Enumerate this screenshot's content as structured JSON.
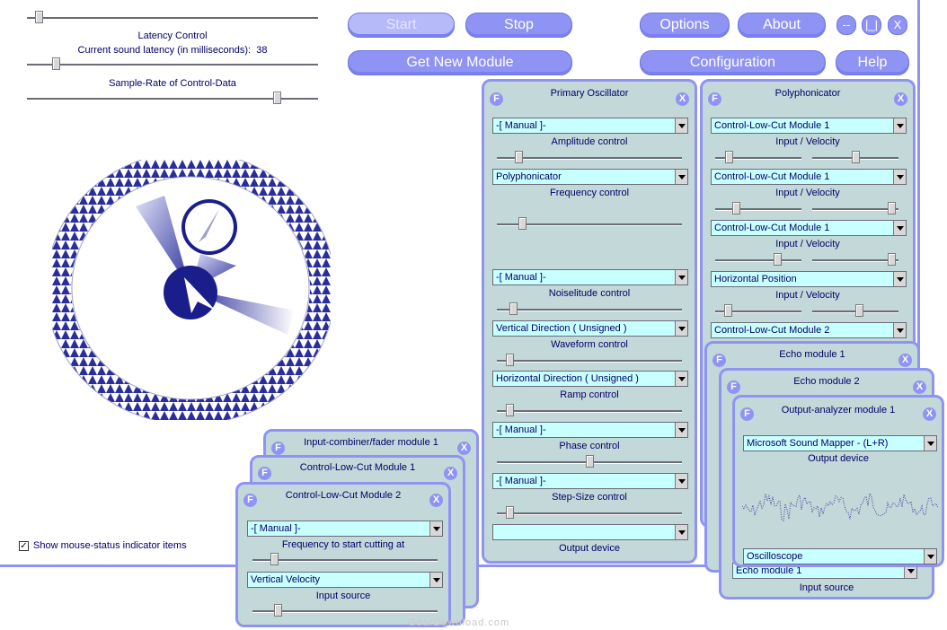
{
  "left": {
    "latency_title": "Latency Control",
    "latency_value_label": "Current sound latency (in milliseconds):",
    "latency_value": "38",
    "samplerate_title": "Sample-Rate of Control-Data",
    "show_mouse_status": "Show mouse-status indicator items",
    "show_mouse_checked": "✓",
    "slider_top": 0.03,
    "slider_latency": 0.09,
    "slider_samplerate": 0.87
  },
  "toolbar": {
    "start": "Start",
    "stop": "Stop",
    "options": "Options",
    "about": "About",
    "minimize": "--",
    "restore": "|_|",
    "close": "X",
    "get_new_module": "Get New Module",
    "configuration": "Configuration",
    "help": "Help"
  },
  "primary_oscillator": {
    "title": "Primary Oscillator",
    "rows": [
      {
        "select": "-[ Manual ]-",
        "label": "Amplitude control",
        "slider": 0.1
      },
      {
        "select": "Polyphonicator",
        "label": "Frequency control",
        "slider": 0.12
      },
      {
        "select": "-[ Manual ]-",
        "label": "Noiselitude control",
        "slider": 0.07
      },
      {
        "select": "Vertical Direction ( Unsigned )",
        "label": "Waveform control",
        "slider": 0.05
      },
      {
        "select": "Horizontal Direction ( Unsigned )",
        "label": "Ramp control",
        "slider": 0.05
      },
      {
        "select": "-[ Manual ]-",
        "label": "Phase control",
        "slider": 0.5
      },
      {
        "select": "-[ Manual ]-",
        "label": "Step-Size control",
        "slider": 0.05
      },
      {
        "select": "",
        "label": "Output device",
        "slider": null
      }
    ]
  },
  "polyphonicator": {
    "title": "Polyphonicator",
    "rows": [
      {
        "select": "Control-Low-Cut Module 1",
        "label": "Input / Velocity",
        "s1": 0.13,
        "s2": 0.5
      },
      {
        "select": "Control-Low-Cut Module 1",
        "label": "Input / Velocity",
        "s1": 0.22,
        "s2": 0.97
      },
      {
        "select": "Control-Low-Cut Module 1",
        "label": "Input / Velocity",
        "s1": 0.75,
        "s2": 0.97
      },
      {
        "select": "Horizontal Position",
        "label": "Input / Velocity",
        "s1": 0.12,
        "s2": 0.55
      },
      {
        "select": "Control-Low-Cut Module 2",
        "label": "",
        "s1": null,
        "s2": null
      }
    ]
  },
  "echo1": {
    "title": "Echo module 1"
  },
  "echo2": {
    "title": "Echo module 2"
  },
  "output_analyzer": {
    "title": "Output-analyzer module 1",
    "device_select": "Microsoft Sound Mapper - (L+R)",
    "device_label": "Output device",
    "mode_select": "Oscilloscope",
    "back_select": "Echo module 1",
    "input_source_label": "Input source"
  },
  "input_combiner": {
    "title": "Input-combiner/fader module 1"
  },
  "lowcut1": {
    "title": "Control-Low-Cut Module 1"
  },
  "lowcut2": {
    "title": "Control-Low-Cut Module 2",
    "select1": "-[ Manual ]-",
    "label1": "Frequency to start cutting at",
    "slider1": 0.1,
    "select2": "Vertical Velocity",
    "label2": "Input source",
    "slider2": 0.12
  },
  "panel_buttons": {
    "f": "F",
    "x": "X"
  },
  "watermark": "GearDownload.com",
  "colors": {
    "accent": "#8f94f4",
    "panel": "#c3d8d8",
    "field": "#c8ffff",
    "text": "#00006a"
  }
}
